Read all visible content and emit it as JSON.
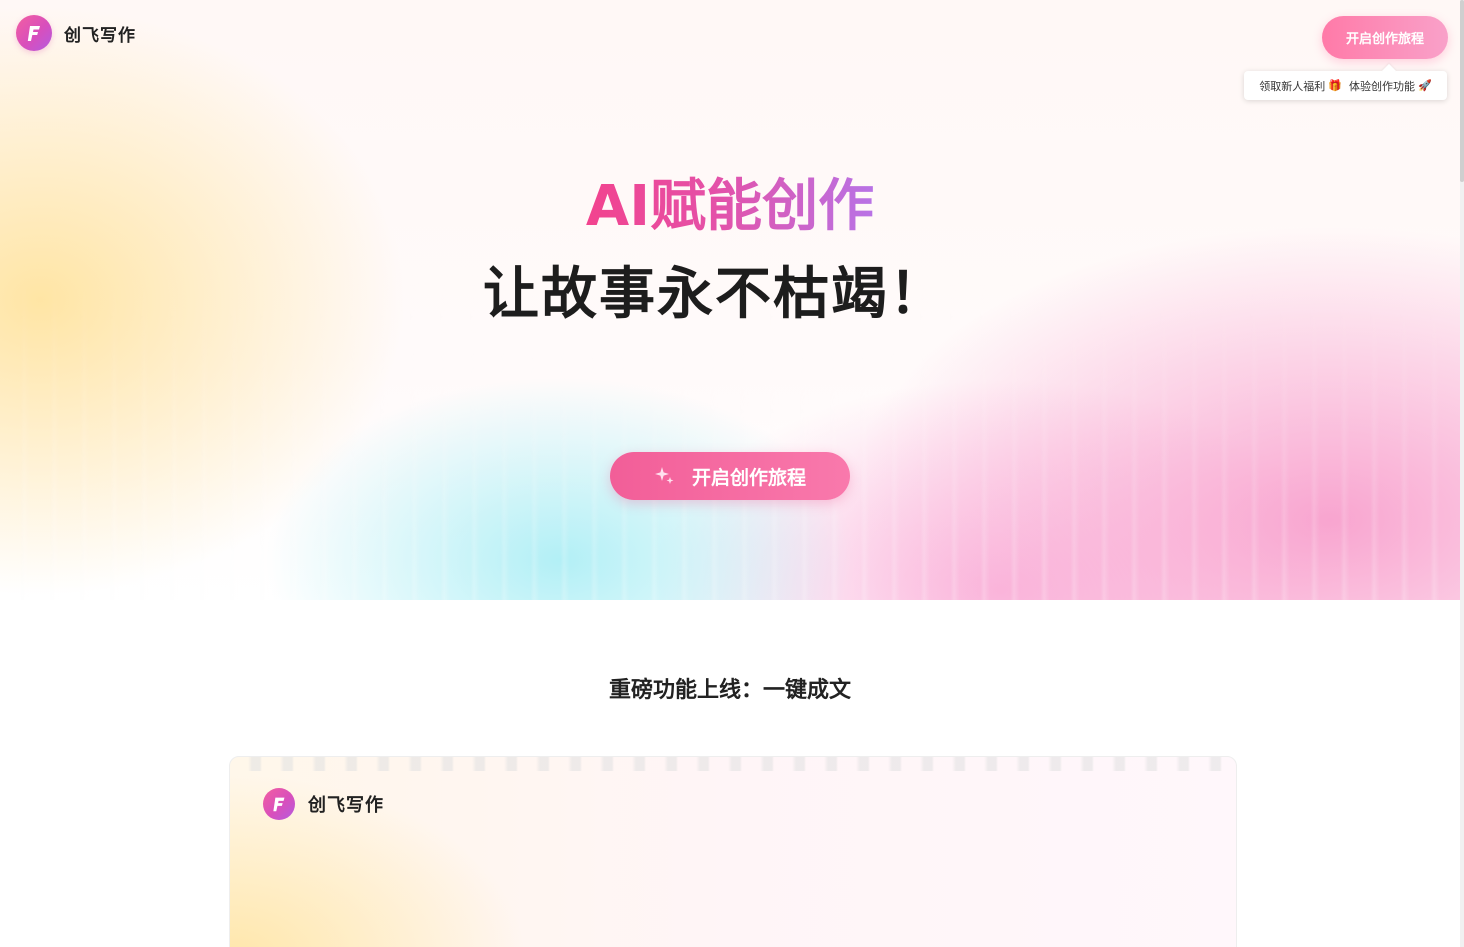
{
  "header": {
    "brand_name": "创飞写作",
    "cta_label": "开启创作旅程",
    "promo_text_1": "领取新人福利",
    "promo_icon_1": "🎁",
    "promo_text_2": "体验创作功能",
    "promo_icon_2": "🚀"
  },
  "hero": {
    "headline_1": "AI赋能创作",
    "headline_2": "让故事永不枯竭！",
    "cta_label": "开启创作旅程"
  },
  "feature_section": {
    "title": "重磅功能上线：一键成文",
    "preview_brand_name": "创飞写作"
  },
  "colors": {
    "accent_pink": "#f25e98",
    "gradient_purple": "#b873e6",
    "text_dark": "#1d1d1d"
  }
}
